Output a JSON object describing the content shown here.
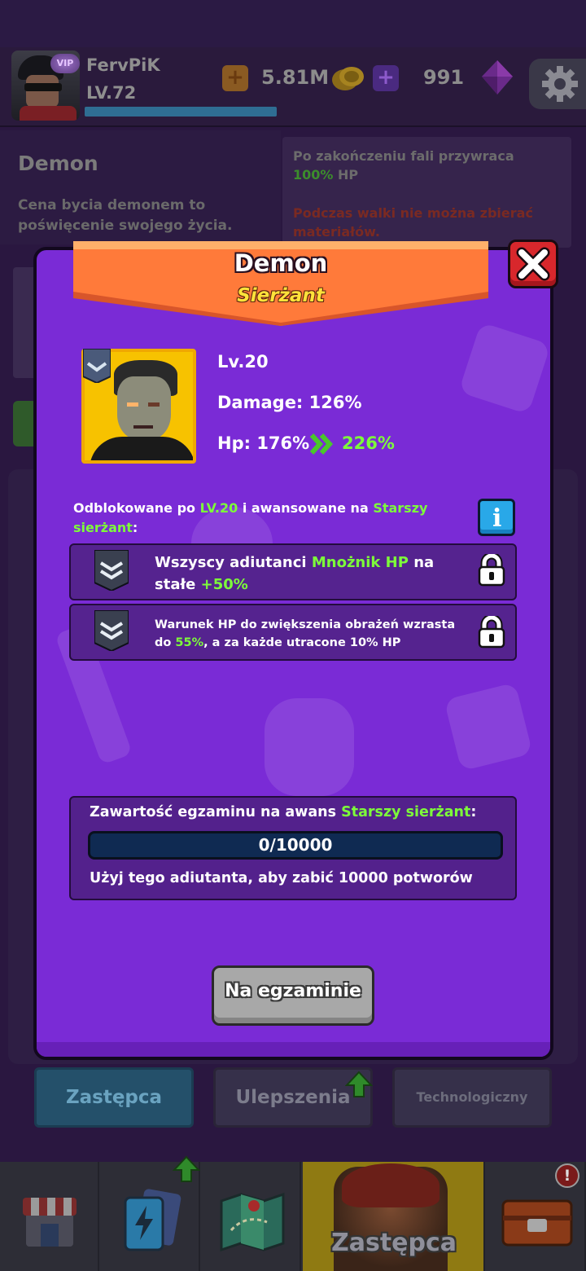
{
  "player": {
    "vip_label": "VIP",
    "name": "FervPiK",
    "level": "LV.72",
    "xp_progress": 1.0,
    "gold": "5.81M",
    "gems": "991"
  },
  "background": {
    "title": "Demon",
    "description": "Cena bycia demonem to poświęcenie swojego życia.",
    "effect_1_pre": "Po zakończeniu fali przywraca ",
    "effect_1_value": "100%",
    "effect_1_post": " HP",
    "effect_2": "Podczas walki nie można zbierać materiałów."
  },
  "tabs": [
    {
      "label": "Zastępca"
    },
    {
      "label": "Ulepszenia"
    },
    {
      "label": "Technologiczny"
    }
  ],
  "bottom_nav": {
    "active_label": "Zastępca",
    "alert": "!"
  },
  "dialog": {
    "title": "Demon",
    "rank": "Sierżant",
    "level": "Lv.20",
    "damage": "Damage: 126%",
    "hp_current": "Hp: 176%",
    "hp_next": "226%",
    "unlock_pre": "Odblokowane po ",
    "unlock_level": "LV.20",
    "unlock_mid": " i awansowane na ",
    "unlock_rank": "Starszy sierżant",
    "unlock_post": ":",
    "info_label": "i",
    "perks": [
      {
        "pre": "Wszyscy adiutanci ",
        "highlight": "Mnożnik HP",
        "mid": " na stałe ",
        "value": "+50%"
      },
      {
        "pre": "Warunek HP do zwiększenia obrażeń wzrasta do ",
        "value": "55%",
        "post": ", a za każde utracone 10% HP"
      }
    ],
    "exam": {
      "title_pre": "Zawartość egzaminu na awans ",
      "title_rank": "Starszy sierżant",
      "title_post": ":",
      "progress_text": "0/10000",
      "progress_fraction": 0.0,
      "description": "Użyj tego adiutanta, aby zabić 10000 potworów"
    },
    "button_label": "Na egzaminie"
  },
  "colors": {
    "modal": "#7a2bd6",
    "ribbon": "#ff7a3a",
    "highlight_green": "#7dfc3a",
    "rank_yellow": "#ffe23a",
    "close_red": "#d8272c",
    "info_blue": "#29a8e8"
  },
  "icons": [
    "gear-icon",
    "coin-icon",
    "gem-icon",
    "close-icon",
    "info-icon",
    "lock-icon",
    "rank-chevron-icon",
    "hp-arrow-icon",
    "arrow-up-icon",
    "shop-icon",
    "cards-icon",
    "map-icon",
    "chest-icon"
  ]
}
